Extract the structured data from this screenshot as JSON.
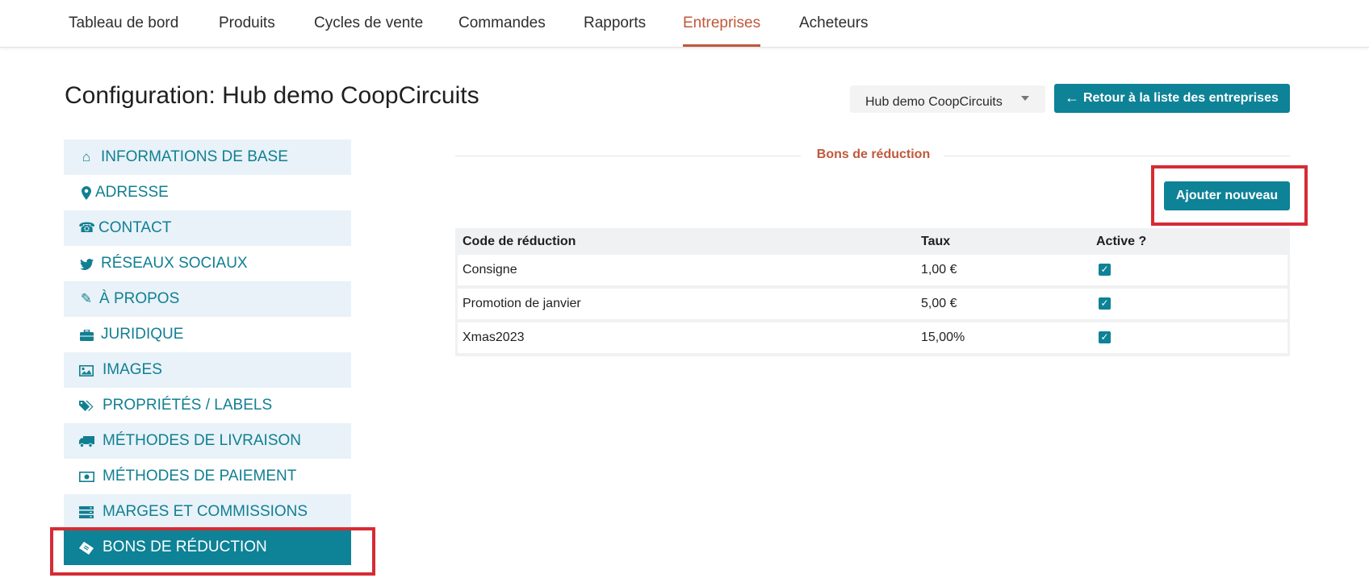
{
  "nav": {
    "items": [
      "Tableau de bord",
      "Produits",
      "Cycles de vente",
      "Commandes",
      "Rapports",
      "Entreprises",
      "Acheteurs"
    ],
    "active": "Entreprises"
  },
  "header": {
    "title": "Configuration: Hub demo CoopCircuits",
    "hub_select_value": "Hub demo CoopCircuits",
    "back_button_label": "Retour à la liste des entreprises"
  },
  "sidebar": {
    "items": [
      {
        "label": "INFORMATIONS DE BASE",
        "icon": "home-icon"
      },
      {
        "label": "ADRESSE",
        "icon": "map-marker-icon"
      },
      {
        "label": "CONTACT",
        "icon": "phone-icon"
      },
      {
        "label": "RÉSEAUX SOCIAUX",
        "icon": "twitter-icon"
      },
      {
        "label": "À PROPOS",
        "icon": "pencil-icon"
      },
      {
        "label": "JURIDIQUE",
        "icon": "briefcase-icon"
      },
      {
        "label": "IMAGES",
        "icon": "picture-icon"
      },
      {
        "label": "PROPRIÉTÉS / LABELS",
        "icon": "tags-icon"
      },
      {
        "label": "MÉTHODES DE LIVRAISON",
        "icon": "truck-icon"
      },
      {
        "label": "MÉTHODES DE PAIEMENT",
        "icon": "money-icon"
      },
      {
        "label": "MARGES ET COMMISSIONS",
        "icon": "server-icon"
      },
      {
        "label": "BONS DE RÉDUCTION",
        "icon": "ticket-icon"
      }
    ],
    "active": "BONS DE RÉDUCTION"
  },
  "vouchers": {
    "legend": "Bons de réduction",
    "add_button_label": "Ajouter nouveau",
    "columns": [
      "Code de réduction",
      "Taux",
      "Active ?"
    ],
    "rows": [
      {
        "code": "Consigne",
        "rate": "1,00 €",
        "active": true
      },
      {
        "code": "Promotion de janvier",
        "rate": "5,00 €",
        "active": true
      },
      {
        "code": "Xmas2023",
        "rate": "15,00%",
        "active": true
      }
    ]
  },
  "colors": {
    "teal": "#0e8296",
    "accent": "#c0583a",
    "highlight": "#d62b35",
    "sidebar_alt": "#e8f2f8"
  }
}
